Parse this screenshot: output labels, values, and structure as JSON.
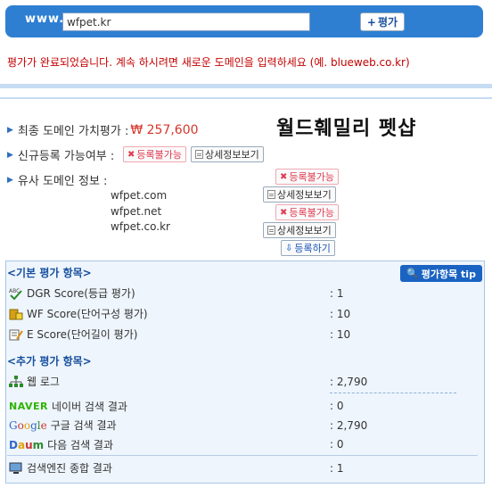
{
  "topbar": {
    "prefix": "www.",
    "domain_value": "wfpet.kr",
    "eval_button": "평가",
    "accent_color": "#2e7fd2"
  },
  "notice": "평가가 완료되었습니다. 계속 하시려면 새로운 도메인을 입력하세요 (예. blueweb.co.kr)",
  "brand_text": "월드훼밀리 펫샵",
  "summary": {
    "final_label": "최종 도메인 가치평가 :",
    "final_value": "₩ 257,600",
    "register_label": "신규등록 가능여부 :",
    "register_status": "등록불가능",
    "register_detail": "상세정보보기",
    "similar_label": "유사 도메인 정보 :",
    "similar_top_status": "등록불가능",
    "similar_domains": [
      {
        "name": "wfpet.com",
        "action": "상세정보보기"
      },
      {
        "name": "wfpet.net",
        "action": "등록불가능"
      },
      {
        "name": "wfpet.co.kr",
        "action": "상세정보보기"
      }
    ],
    "register_button": "등록하기"
  },
  "panel": {
    "basic_title": "<기본 평가 항목>",
    "tip_button": "평가항목 tip",
    "basic_items": [
      {
        "icon": "abc-spellcheck-icon",
        "label": "DGR Score(등급 평가)",
        "value": ": 1"
      },
      {
        "icon": "building-blocks-icon",
        "label": "WF Score(단어구성 평가)",
        "value": ": 10"
      },
      {
        "icon": "pencil-note-icon",
        "label": "E Score(단어길이 평가)",
        "value": ": 10"
      }
    ],
    "extra_title": "<추가 평가 항목>",
    "extra_items": [
      {
        "icon": "sitemap-icon",
        "label": "웹 로그",
        "value": ": 2,790"
      },
      {
        "icon": "naver-logo",
        "brand": "NAVER",
        "label": "네이버 검색 결과",
        "value": ": 0"
      },
      {
        "icon": "google-logo",
        "brand": "Google",
        "label": "구글 검색 결과",
        "value": ": 2,790"
      },
      {
        "icon": "daum-logo",
        "brand": "Daum",
        "label": "다음 검색 결과",
        "value": ": 0"
      },
      {
        "icon": "monitor-icon",
        "label": "검색엔진 종합 결과",
        "value": ": 1"
      }
    ]
  }
}
